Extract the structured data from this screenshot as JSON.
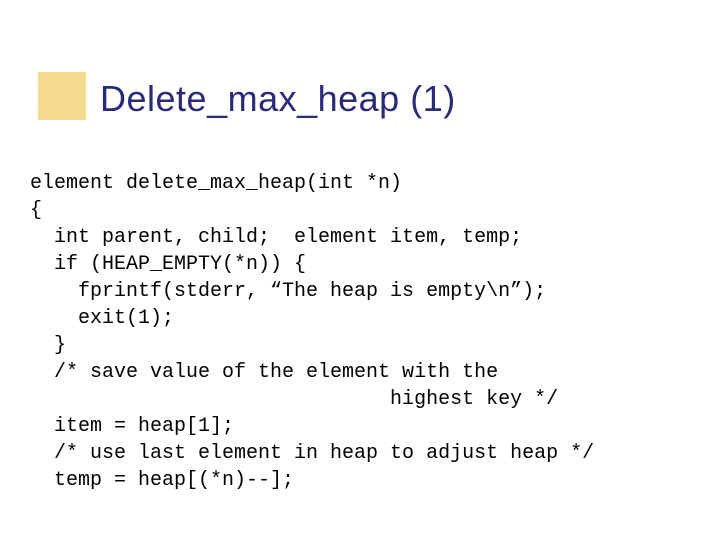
{
  "title": "Delete_max_heap (1)",
  "code": {
    "l0": "element delete_max_heap(int *n)",
    "l1": "{",
    "l2": "  int parent, child;  element item, temp;",
    "l3": "  if (HEAP_EMPTY(*n)) {",
    "l4": "    fprintf(stderr, “The heap is empty\\n”);",
    "l5": "    exit(1);",
    "l6": "  }",
    "l7": "  /* save value of the element with the ",
    "l8": "                              highest key */",
    "l9": "  item = heap[1];",
    "l10": "  /* use last element in heap to adjust heap */",
    "l11": "  temp = heap[(*n)--];"
  }
}
